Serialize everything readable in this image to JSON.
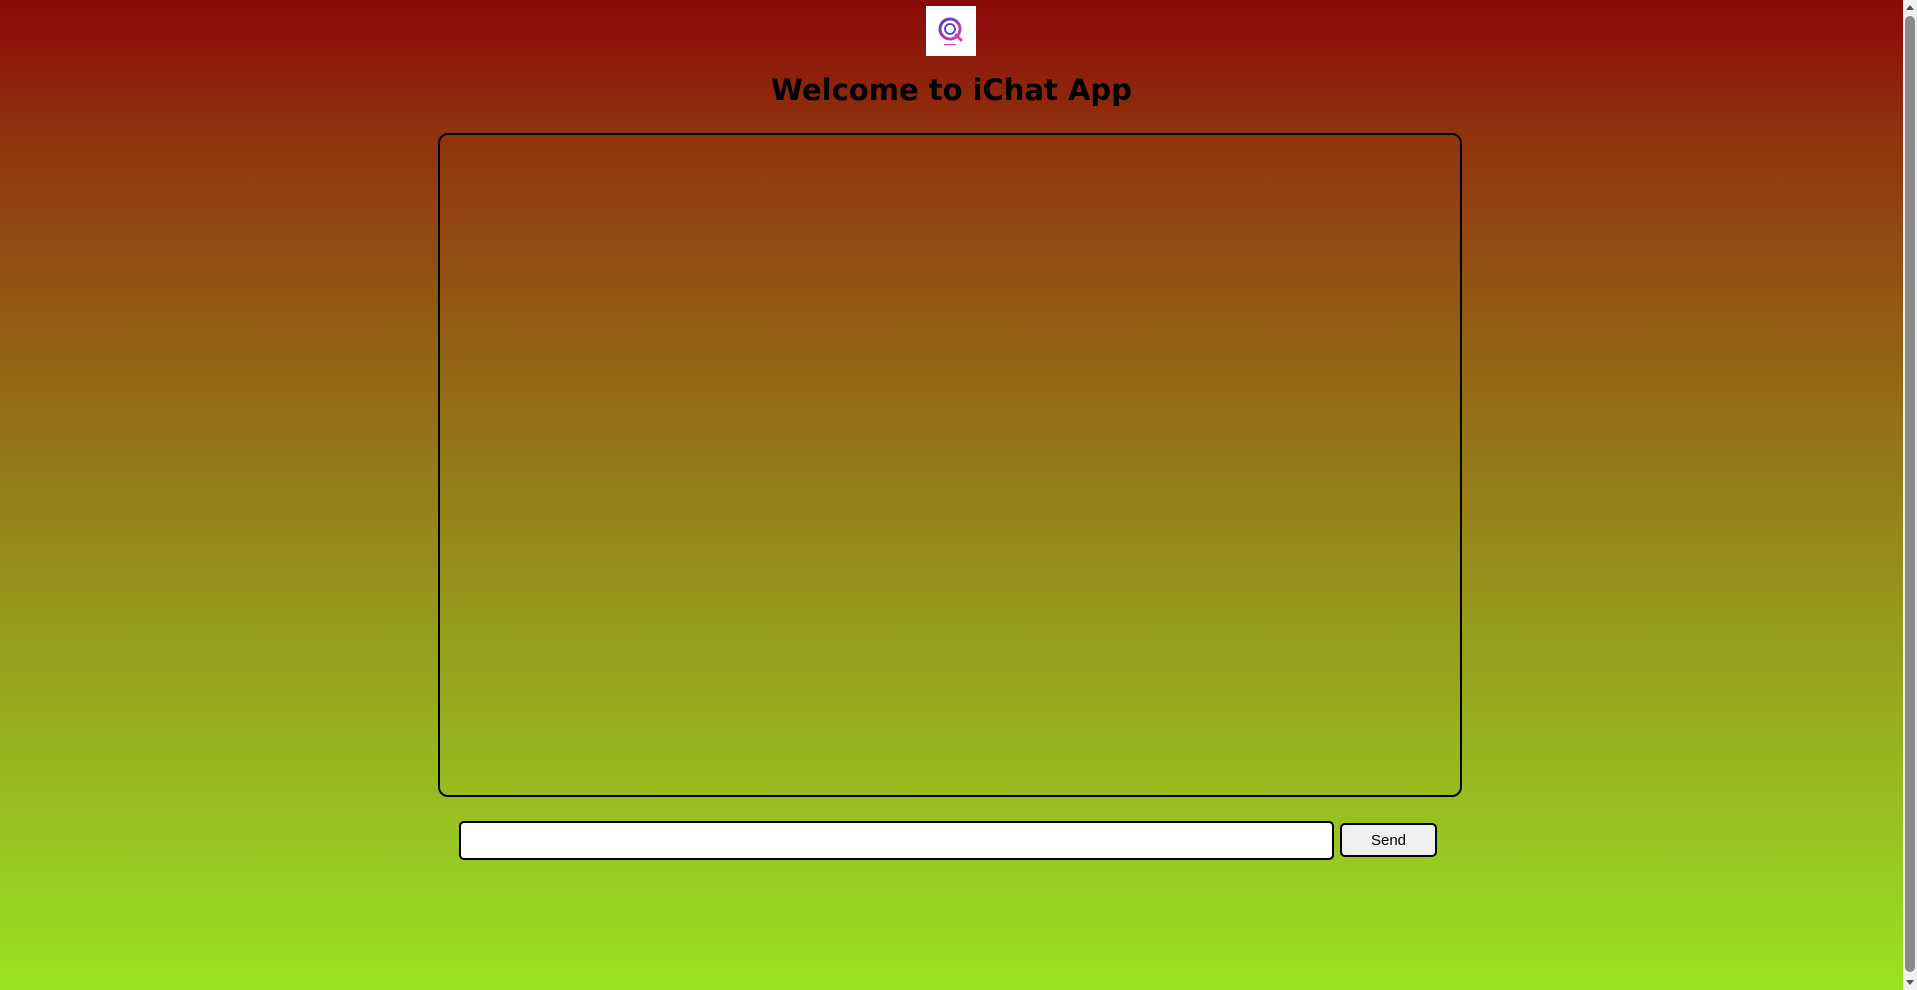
{
  "header": {
    "logo_icon": "ichat-logo-icon",
    "title": "Welcome to iChat App"
  },
  "chat": {
    "messages": []
  },
  "composer": {
    "input_value": "",
    "input_placeholder": "",
    "send_label": "Send"
  },
  "colors": {
    "gradient_top": "#8b0808",
    "gradient_bottom": "#99e323",
    "logo_accent_blue": "#4b3fd6",
    "logo_accent_pink": "#d63fb0"
  }
}
